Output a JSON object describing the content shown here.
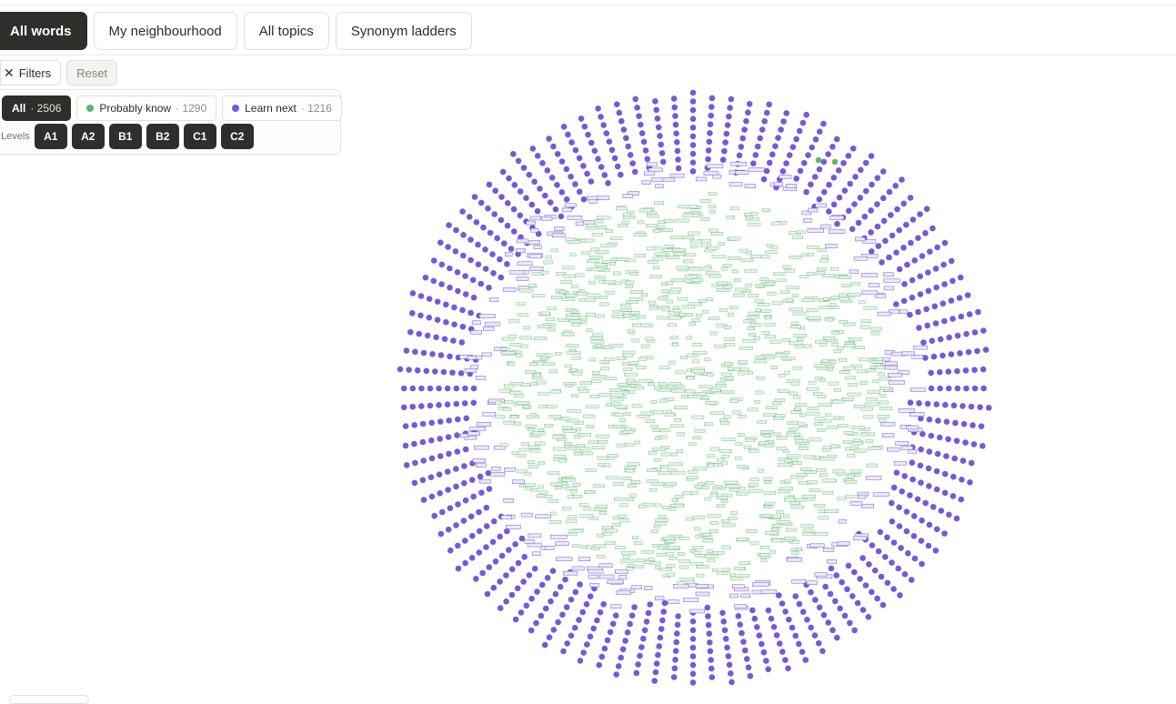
{
  "tabs": [
    {
      "label": "All words",
      "active": true
    },
    {
      "label": "My neighbourhood",
      "active": false
    },
    {
      "label": "All topics",
      "active": false
    },
    {
      "label": "Synonym ladders",
      "active": false
    }
  ],
  "filter_bar": {
    "filters_label": "Filters",
    "close_icon": "close-icon",
    "reset_label": "Reset"
  },
  "status_chips": [
    {
      "label": "All",
      "count": "· 2506",
      "active": true
    },
    {
      "label": "Probably know",
      "count": "· 1290",
      "dot_color": "#5cb86f",
      "active": false
    },
    {
      "label": "Learn next",
      "count": "· 1216",
      "dot_color": "#7559d6",
      "active": false
    }
  ],
  "levels": {
    "label": "Levels",
    "items": [
      "A1",
      "A2",
      "B1",
      "B2",
      "C1",
      "C2"
    ]
  },
  "graph": {
    "colors": {
      "learn_next": "#7559d6",
      "probably_know": "#5cb86f",
      "learn_next_label_bg": "#ece8fb",
      "probably_know_label_bg": "#e6f3e8"
    },
    "legend_counts": {
      "probably_know": 1290,
      "learn_next": 1216
    }
  }
}
